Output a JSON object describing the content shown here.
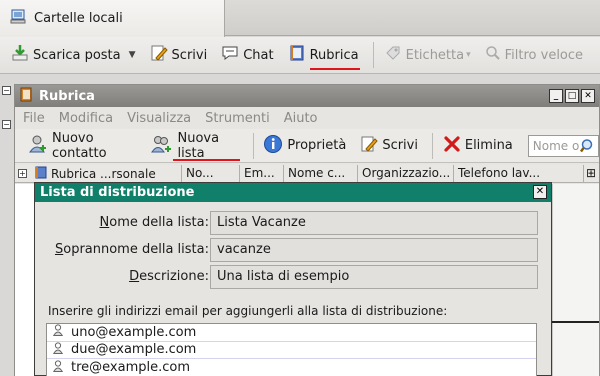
{
  "tab": {
    "label": "Cartelle locali"
  },
  "main_toolbar": {
    "get_mail": "Scarica posta",
    "write": "Scrivi",
    "chat": "Chat",
    "address_book": "Rubrica",
    "tag": "Etichetta",
    "quick_filter": "Filtro veloce"
  },
  "address_book": {
    "title": "Rubrica",
    "menu": [
      "File",
      "Modifica",
      "Visualizza",
      "Strumenti",
      "Aiuto"
    ],
    "toolbar": {
      "new_contact": "Nuovo contatto",
      "new_list": "Nuova lista",
      "properties": "Proprietà",
      "write": "Scrivi",
      "delete": "Elimina",
      "search_placeholder": "Nome o"
    },
    "tree_header": "Rubrica ...rsonale",
    "columns": [
      "No...",
      "Em...",
      "Nome c...",
      "Organizzazio...",
      "Telefono lav..."
    ]
  },
  "dialog": {
    "title": "Lista di distribuzione",
    "list_name_label": "Nome della lista:",
    "list_name_value": "Lista Vacanze",
    "nickname_label": "Soprannome della lista:",
    "nickname_value": "vacanze",
    "description_label": "Descrizione:",
    "description_value": "Una lista di esempio",
    "instruction": "Inserire gli indirizzi email per aggiungerli alla lista di distribuzione:",
    "emails": [
      "uno@example.com",
      "due@example.com",
      "tre@example.com"
    ]
  },
  "colors": {
    "dialog_title": "#11806a",
    "highlight_underline": "#e0141d"
  }
}
